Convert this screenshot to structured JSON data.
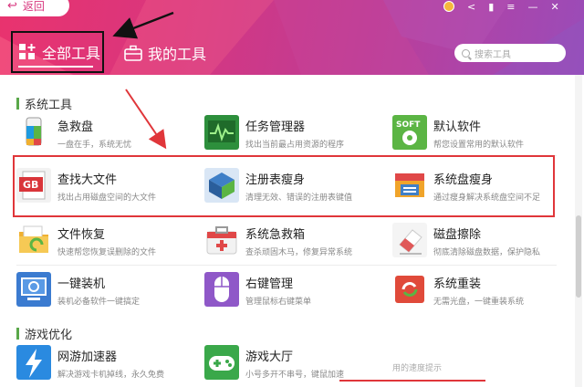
{
  "header": {
    "back_label": "返回",
    "tabs": [
      {
        "label": "全部工具",
        "icon": "grid-plus-icon",
        "active": true
      },
      {
        "label": "我的工具",
        "icon": "toolbox-icon",
        "active": false
      }
    ],
    "search_placeholder": "搜索工具"
  },
  "sections": [
    {
      "title": "系统工具"
    },
    {
      "title": "游戏优化"
    }
  ],
  "tools": [
    {
      "name": "急救盘",
      "desc": "一盘在手，系统无忧",
      "icon": "usb-drive-icon",
      "color": "#1e9be0"
    },
    {
      "name": "任务管理器",
      "desc": "找出当前最占用资源的程序",
      "icon": "task-monitor-icon",
      "color": "#2d8f3c"
    },
    {
      "name": "默认软件",
      "desc": "帮您设置常用的默认软件",
      "icon": "soft-default-icon",
      "color": "#5bb544"
    },
    {
      "name": "查找大文件",
      "desc": "找出占用磁盘空间的大文件",
      "icon": "gb-file-icon",
      "color": "#d9353a"
    },
    {
      "name": "注册表瘦身",
      "desc": "清理无效、错误的注册表键值",
      "icon": "registry-cube-icon",
      "color": "#3f7fc7"
    },
    {
      "name": "系统盘瘦身",
      "desc": "通过瘦身解决系统盘空间不足",
      "icon": "system-disk-icon",
      "color": "#f0a42a"
    },
    {
      "name": "文件恢复",
      "desc": "快速帮您恢复误删除的文件",
      "icon": "folder-restore-icon",
      "color": "#f0b030"
    },
    {
      "name": "系统急救箱",
      "desc": "查杀顽固木马，修复异常系统",
      "icon": "first-aid-icon",
      "color": "#e04848"
    },
    {
      "name": "磁盘擦除",
      "desc": "彻底清除磁盘数据，保护隐私",
      "icon": "eraser-icon",
      "color": "#e05858"
    },
    {
      "name": "一键装机",
      "desc": "装机必备软件一键搞定",
      "icon": "monitor-install-icon",
      "color": "#3b7bd0"
    },
    {
      "name": "右键管理",
      "desc": "管理鼠标右键菜单",
      "icon": "mouse-icon",
      "color": "#8f58c8"
    },
    {
      "name": "系统重装",
      "desc": "无需光盘，一键重装系统",
      "icon": "reinstall-icon",
      "color": "#e04a3a"
    },
    {
      "name": "网游加速器",
      "desc": "解决游戏卡机掉线，永久免费",
      "icon": "lightning-icon",
      "color": "#2a8ae0"
    },
    {
      "name": "游戏大厅",
      "desc": "小号多开不串号，键鼠加速",
      "icon": "gamepad-icon",
      "color": "#3aa84a"
    }
  ],
  "peek_text": "用的速度提示"
}
